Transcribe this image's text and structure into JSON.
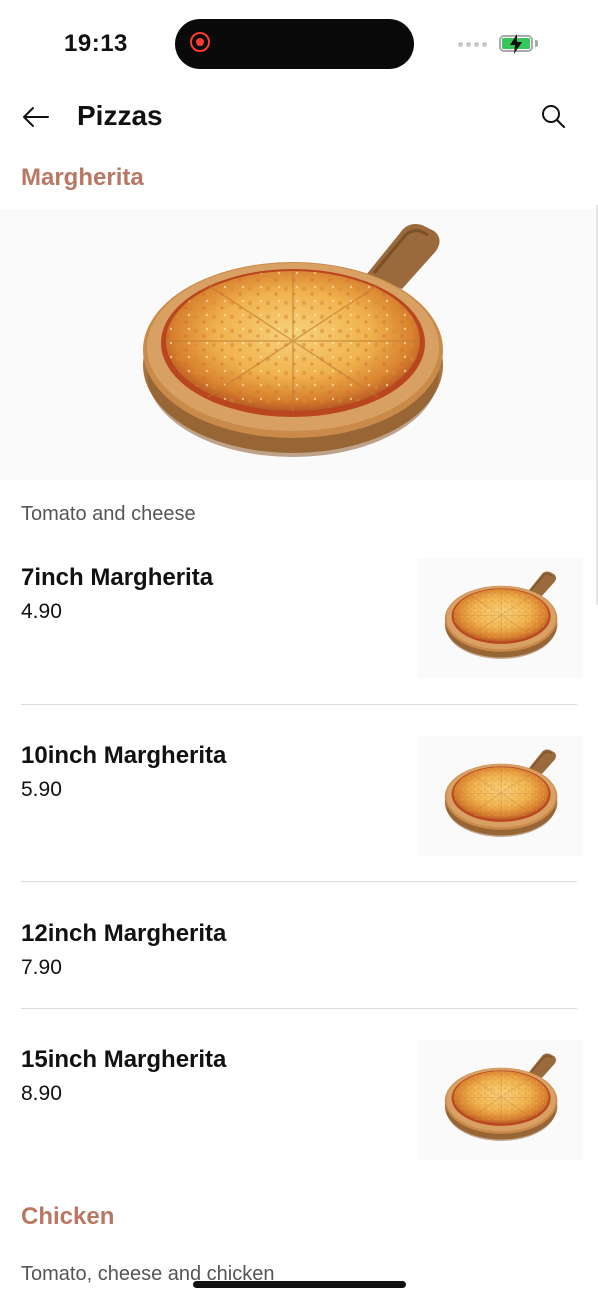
{
  "status": {
    "time": "19:13"
  },
  "header": {
    "title": "Pizzas"
  },
  "sections": [
    {
      "title": "Margherita",
      "description": "Tomato and cheese",
      "items": [
        {
          "name": "7inch Margherita",
          "price": "4.90"
        },
        {
          "name": "10inch Margherita",
          "price": "5.90"
        },
        {
          "name": "12inch Margherita",
          "price": "7.90"
        },
        {
          "name": "15inch Margherita",
          "price": "8.90"
        }
      ]
    },
    {
      "title": "Chicken",
      "description": "Tomato, cheese and chicken"
    }
  ],
  "colors": {
    "accent": "#b97764",
    "text": "#111111",
    "muted": "#555555",
    "divider": "#dcdcdc",
    "battery": "#34c759",
    "record": "#ff3b30"
  },
  "icons": [
    "back-arrow-icon",
    "search-icon",
    "record-icon",
    "battery-charging-icon",
    "pizza-image"
  ]
}
